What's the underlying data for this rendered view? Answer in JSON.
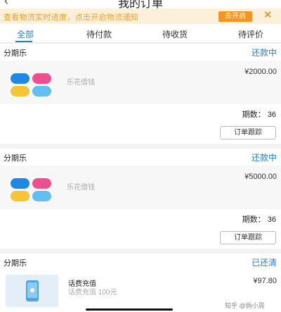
{
  "header": {
    "title": "我的订单",
    "back_icon": "back-chevron-icon"
  },
  "notice": {
    "text": "查看物流实时进度，点击开启物流通知",
    "button_label": "去开启",
    "close_icon": "close-icon"
  },
  "tabs": [
    {
      "label": "全部",
      "active": true
    },
    {
      "label": "待付款",
      "active": false
    },
    {
      "label": "待收货",
      "active": false
    },
    {
      "label": "待评价",
      "active": false
    }
  ],
  "orders": [
    {
      "store": "分期乐",
      "status": "还款中",
      "goods_name": "乐花借钱",
      "price": "¥2000.00",
      "periods_label": "期数：",
      "periods_value": "36",
      "track_label": "订单跟踪"
    },
    {
      "store": "分期乐",
      "status": "还款中",
      "goods_name": "乐花借钱",
      "price": "¥5000.00",
      "periods_label": "期数：",
      "periods_value": "36",
      "track_label": "订单跟踪"
    },
    {
      "store": "分期乐",
      "status": "已还清",
      "goods_name": "话费充值",
      "goods_desc": "话费充值 100元",
      "price": "¥97.80"
    }
  ],
  "colors": {
    "accent": "#1d7fd6",
    "notice_bg": "#fdf0db",
    "notice_text": "#f0a020",
    "notice_button": "#f7941d"
  },
  "watermark": "知乎 @倘小周"
}
